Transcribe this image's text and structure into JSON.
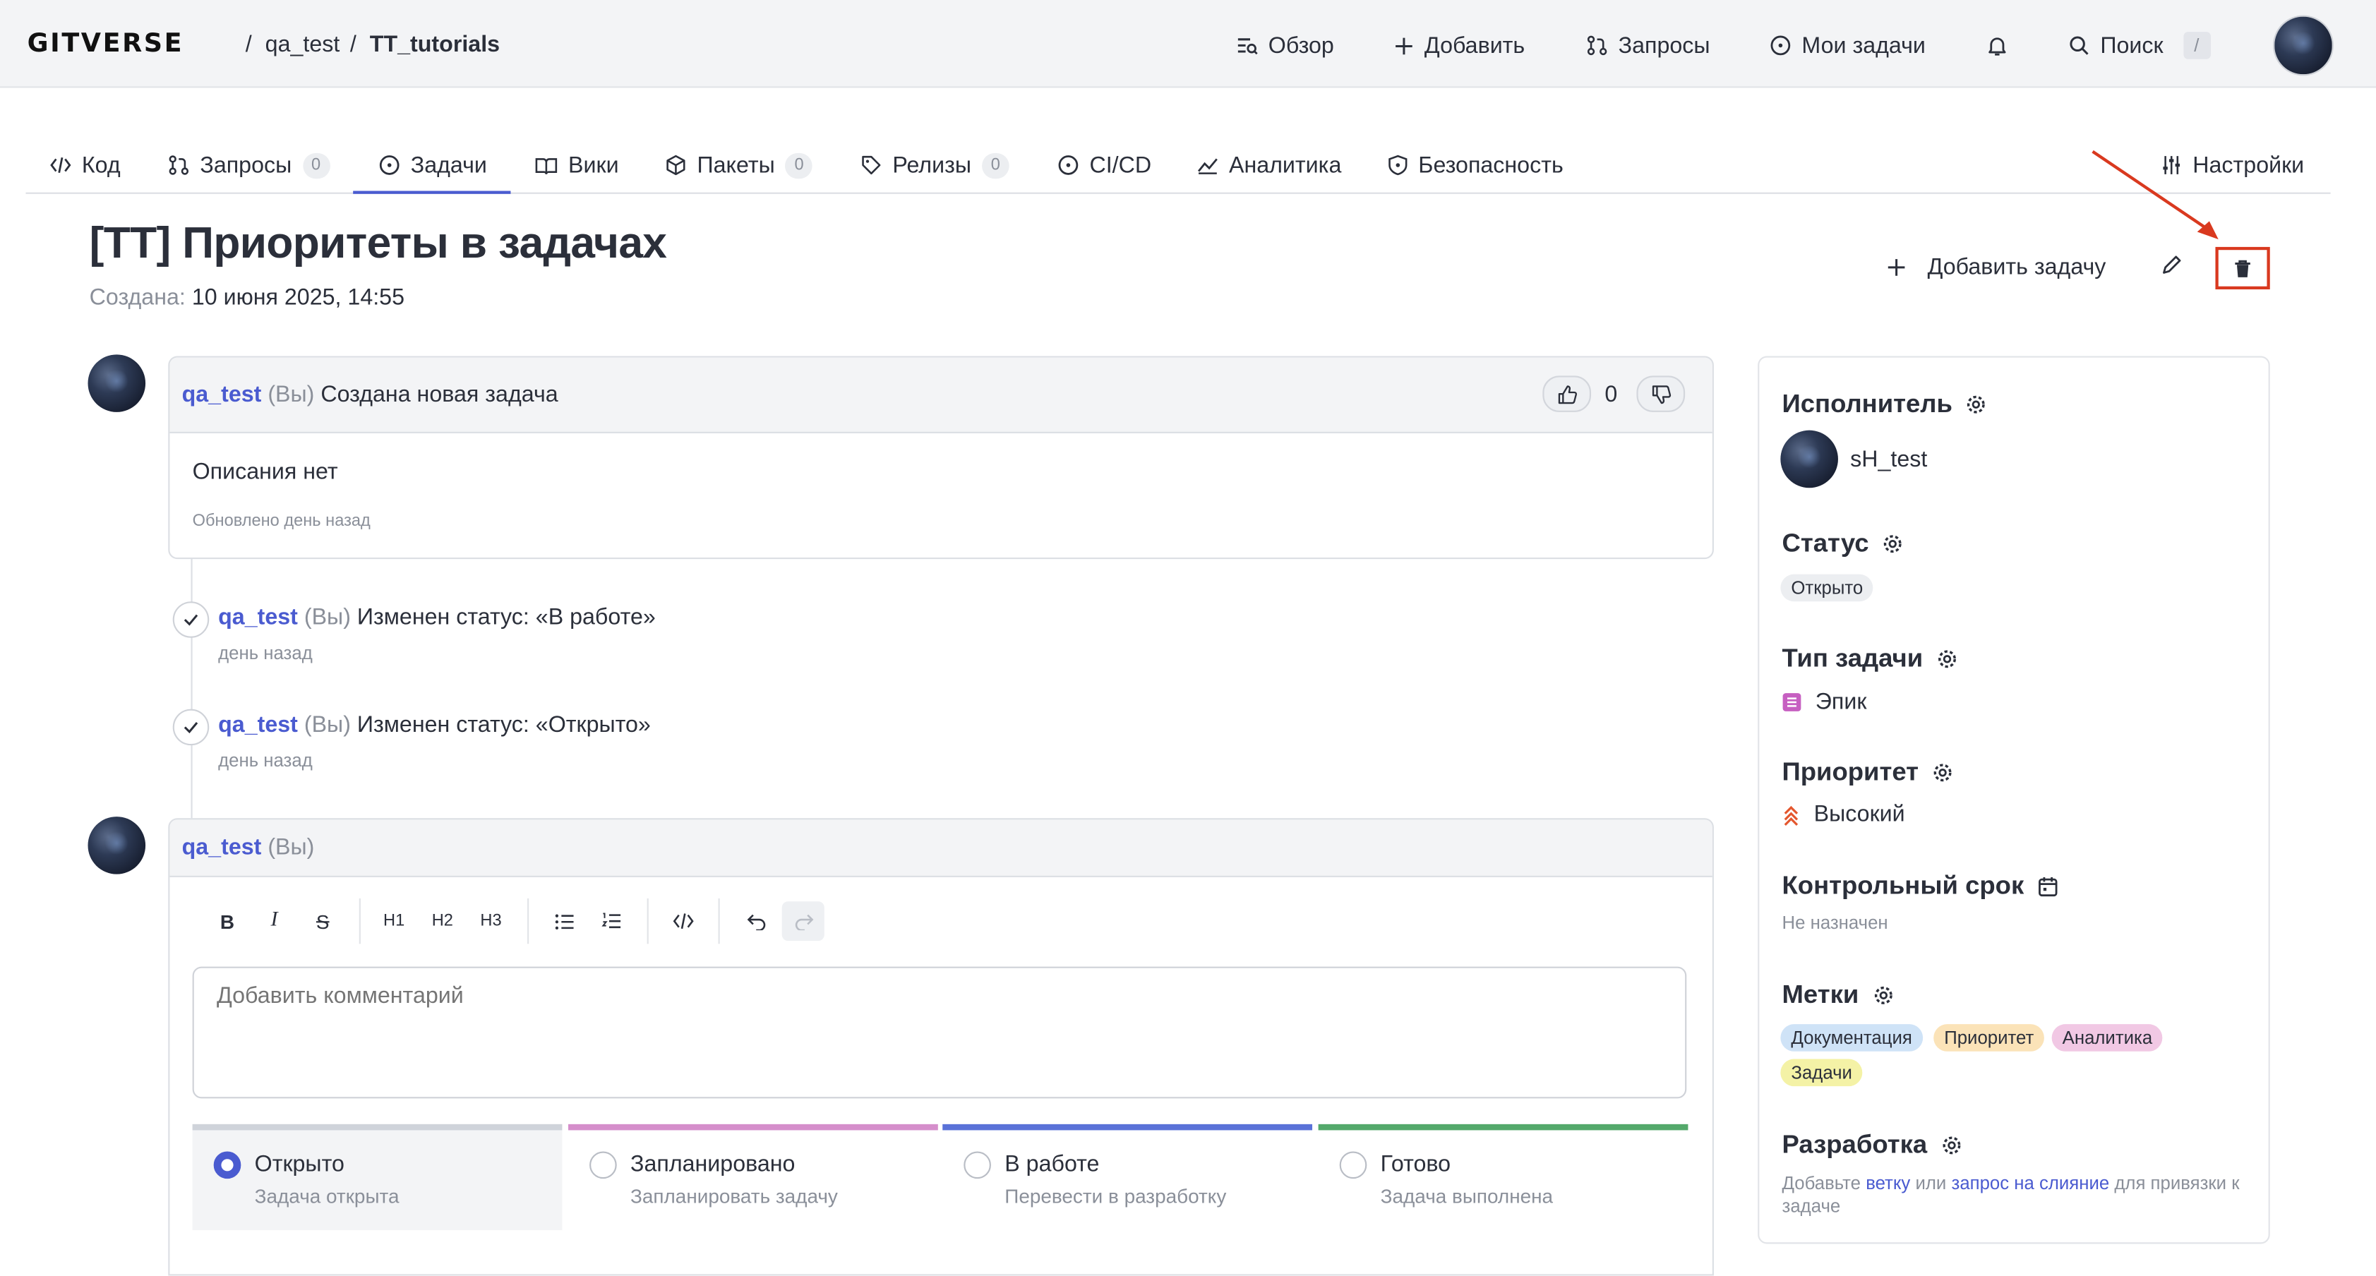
{
  "topbar": {
    "logo": "GITVERSE",
    "breadcrumb": [
      "qa_test",
      "TT_tutorials"
    ],
    "separator": "/",
    "nav": [
      {
        "label": "Обзор",
        "icon": "overview-icon"
      },
      {
        "label": "Добавить",
        "icon": "plus-icon"
      },
      {
        "label": "Запросы",
        "icon": "pull-request-icon"
      },
      {
        "label": "Мои задачи",
        "icon": "issue-circle-icon"
      }
    ],
    "search_label": "Поиск",
    "search_shortcut": "/"
  },
  "tabs": [
    {
      "label": "Код",
      "icon": "code-icon"
    },
    {
      "label": "Запросы",
      "count": "0",
      "icon": "pull-request-icon"
    },
    {
      "label": "Задачи",
      "icon": "issue-circle-icon",
      "active": true
    },
    {
      "label": "Вики",
      "icon": "book-icon"
    },
    {
      "label": "Пакеты",
      "count": "0",
      "icon": "package-icon"
    },
    {
      "label": "Релизы",
      "count": "0",
      "icon": "tag-icon"
    },
    {
      "label": "CI/CD",
      "icon": "ci-icon"
    },
    {
      "label": "Аналитика",
      "icon": "chart-line-icon"
    },
    {
      "label": "Безопасность",
      "icon": "shield-icon"
    }
  ],
  "settings_tab": "Настройки",
  "issue": {
    "title": "[TT] Приоритеты в задачах",
    "created_label": "Создана:",
    "created_value": "10 июня 2025, 14:55",
    "add_task_label": "Добавить задачу"
  },
  "first_comment": {
    "user": "qa_test",
    "you": "(Вы)",
    "text": "Создана новая задача",
    "votes": "0",
    "body": "Описания нет",
    "updated": "Обновлено день назад"
  },
  "events": [
    {
      "user": "qa_test",
      "you": "(Вы)",
      "text": "Изменен статус: «В работе»",
      "time": "день назад"
    },
    {
      "user": "qa_test",
      "you": "(Вы)",
      "text": "Изменен статус: «Открыто»",
      "time": "день назад"
    }
  ],
  "composer": {
    "user": "qa_test",
    "you": "(Вы)",
    "placeholder": "Добавить комментарий",
    "toolbar": [
      "B",
      "I",
      "S",
      "H1",
      "H2",
      "H3"
    ]
  },
  "statuses": [
    {
      "name": "Открыто",
      "desc": "Задача открыта",
      "color": "#cfd3da",
      "selected": true
    },
    {
      "name": "Запланировано",
      "desc": "Запланировать задачу",
      "color": "#d58ecb"
    },
    {
      "name": "В работе",
      "desc": "Перевести в разработку",
      "color": "#5a72d8"
    },
    {
      "name": "Готово",
      "desc": "Задача выполнена",
      "color": "#54a96b"
    }
  ],
  "sidebar": {
    "assignee_h": "Исполнитель",
    "assignee": "sH_test",
    "status_h": "Статус",
    "status": "Открыто",
    "type_h": "Тип задачи",
    "type": "Эпик",
    "priority_h": "Приоритет",
    "priority": "Высокий",
    "deadline_h": "Контрольный срок",
    "deadline": "Не назначен",
    "labels_h": "Метки",
    "labels": [
      {
        "text": "Документация",
        "bg": "#cfe3f7"
      },
      {
        "text": "Приоритет",
        "bg": "#fbe3b8"
      },
      {
        "text": "Аналитика",
        "bg": "#f1c8e4"
      },
      {
        "text": "Задачи",
        "bg": "#f4f2a6"
      }
    ],
    "dev_h": "Разработка",
    "dev_prefix": "Добавьте",
    "dev_link1": "ветку",
    "dev_or": "или",
    "dev_link2": "запрос на слияние",
    "dev_suffix1": "для привязки к",
    "dev_suffix2": "задаче"
  },
  "colors": {
    "accent": "#4a5bd0",
    "annotation": "#d9391f"
  }
}
